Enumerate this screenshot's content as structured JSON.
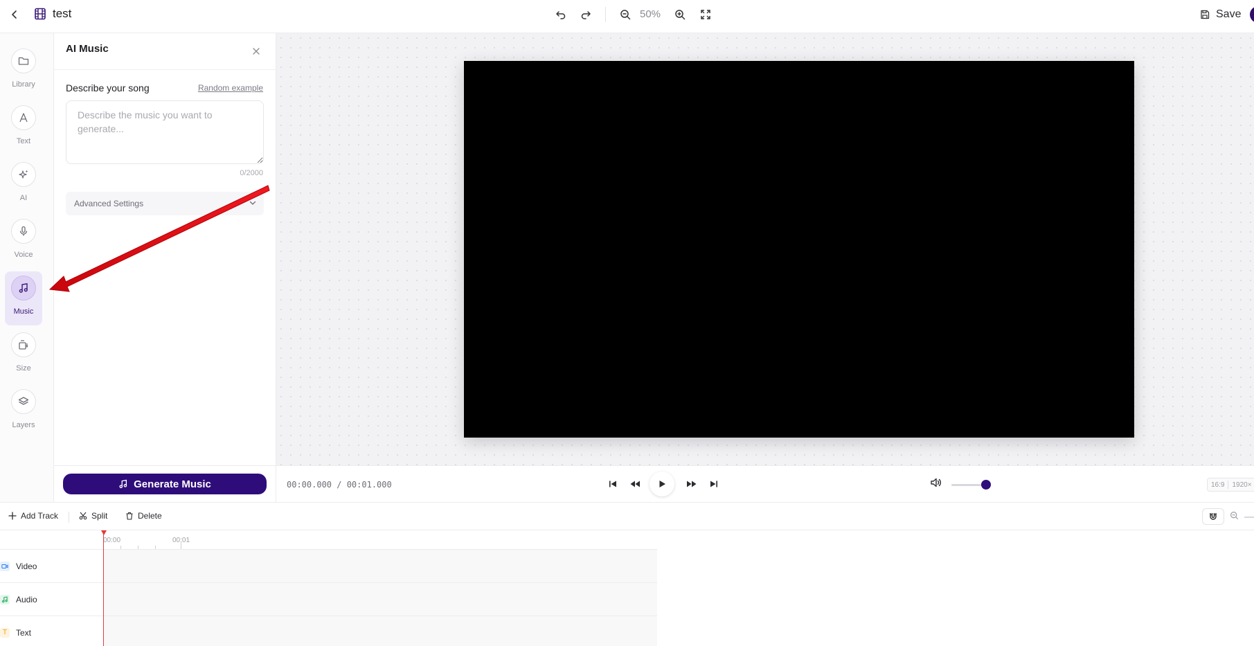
{
  "topbar": {
    "project_title": "test",
    "zoom_level": "50%",
    "save_label": "Save"
  },
  "sidebar": {
    "items": [
      {
        "label": "Library",
        "icon": "folder-icon"
      },
      {
        "label": "Text",
        "icon": "text-icon"
      },
      {
        "label": "AI",
        "icon": "sparkle-icon"
      },
      {
        "label": "Voice",
        "icon": "microphone-icon"
      },
      {
        "label": "Music",
        "icon": "music-note-icon",
        "active": true
      },
      {
        "label": "Size",
        "icon": "resize-icon"
      },
      {
        "label": "Layers",
        "icon": "layers-icon"
      }
    ]
  },
  "panel": {
    "title": "AI Music",
    "song_label": "Describe your song",
    "random_example": "Random example",
    "textarea_placeholder": "Describe the music you want to generate...",
    "textarea_value": "",
    "char_count": "0/2000",
    "advanced_settings": "Advanced Settings",
    "generate_label": "Generate Music"
  },
  "player": {
    "timecode": "00:00.000 / 00:01.000",
    "volume_fraction": 0.88,
    "aspect_ratio": "16:9",
    "resolution": "1920×"
  },
  "timeline_toolbar": {
    "add_track": "Add Track",
    "split": "Split",
    "delete": "Delete"
  },
  "timeline": {
    "ticks": [
      "00:00",
      "00:01"
    ],
    "tracks": [
      {
        "label": "Video",
        "color": "#2f80ed"
      },
      {
        "label": "Audio",
        "color": "#27ae60"
      },
      {
        "label": "Text",
        "color": "#f2a007"
      }
    ]
  },
  "colors": {
    "accent": "#2e0d7a",
    "active_bg": "#ece7f8",
    "playhead": "#e53935",
    "annotation": "#e8141a"
  }
}
